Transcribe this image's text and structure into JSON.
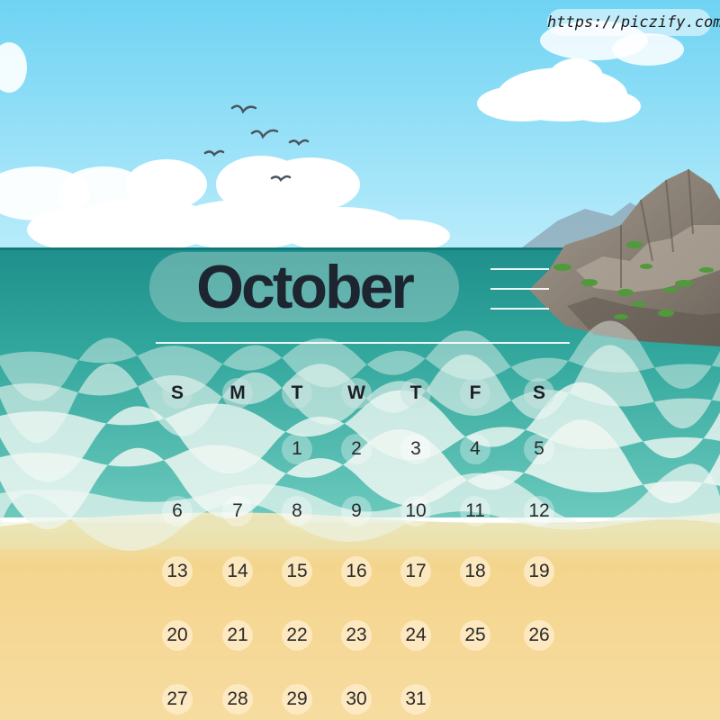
{
  "watermark": "https://piczify.com",
  "month": "October",
  "weekdays": [
    "S",
    "M",
    "T",
    "W",
    "T",
    "F",
    "S"
  ],
  "weeks": [
    [
      "",
      "",
      "",
      "1",
      "2",
      "3",
      "4",
      "5"
    ],
    [
      "6",
      "7",
      "8",
      "9",
      "10",
      "11",
      "12"
    ],
    [
      "13",
      "14",
      "15",
      "16",
      "17",
      "18",
      "19"
    ],
    [
      "20",
      "21",
      "22",
      "23",
      "24",
      "25",
      "26"
    ],
    [
      "27",
      "28",
      "29",
      "30",
      "31",
      "",
      ""
    ]
  ],
  "colors": {
    "sky_top": "#6fd3f3",
    "sky_bottom": "#b9ecfb",
    "sea_deep": "#1f8f8c",
    "sea_light": "#6cc9bd",
    "surf": "#e8f4ef",
    "sand": "#f4d58d",
    "rock": "#8a8076",
    "title": "#1d2530"
  }
}
